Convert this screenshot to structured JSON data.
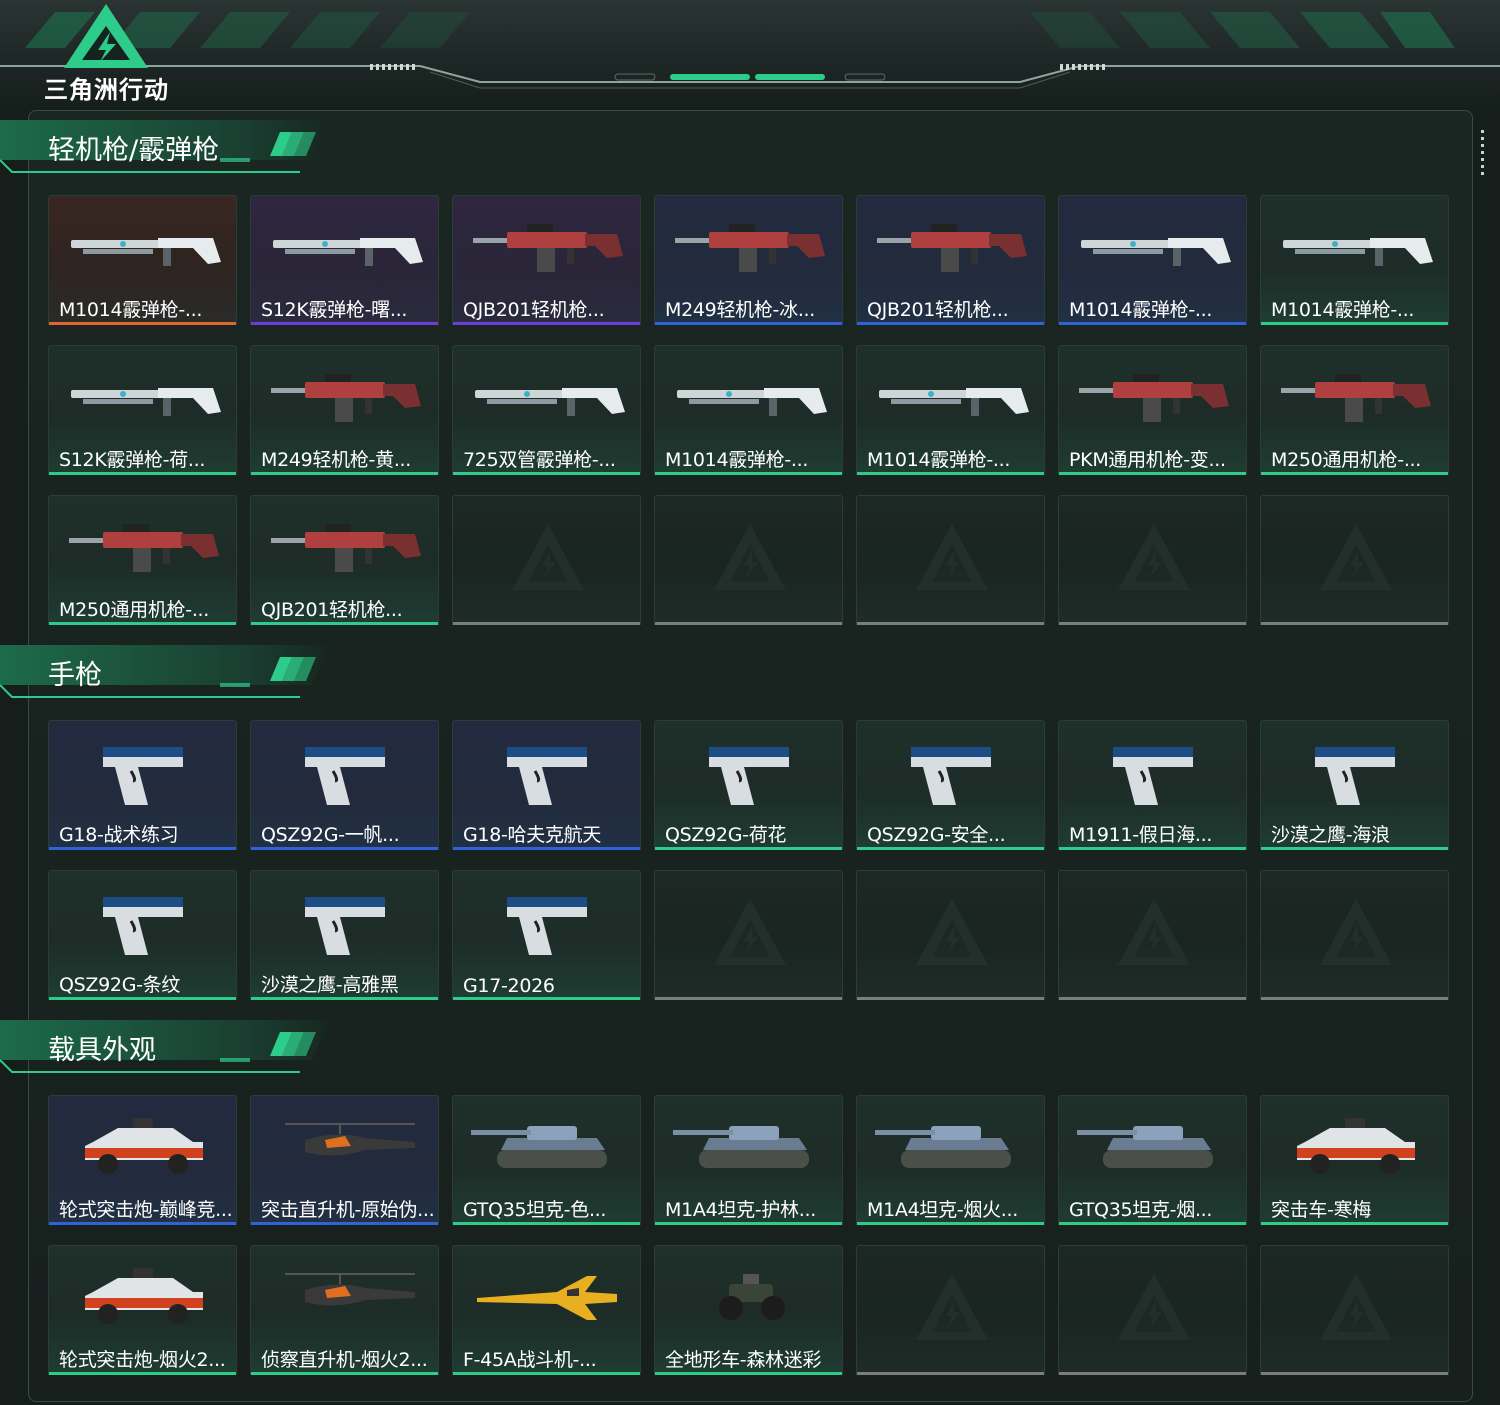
{
  "app": {
    "logo_text": "三角洲行动"
  },
  "colors": {
    "accent": "#2ecc8a",
    "bar_orange": "#e0652a",
    "bar_purple": "#6a3fd8",
    "bar_blue": "#2e63d9",
    "bar_green": "#2ecc8a",
    "bar_gray": "#7a7f7d"
  },
  "sections": [
    {
      "title": "轻机枪/霰弹枪",
      "items": [
        {
          "name": "M1014霰弹枪-...",
          "rarity": "orange",
          "icon": "shotgun-icon"
        },
        {
          "name": "S12K霰弹枪-曙...",
          "rarity": "purple",
          "icon": "shotgun-icon"
        },
        {
          "name": "QJB201轻机枪...",
          "rarity": "purple",
          "icon": "machine-gun-icon"
        },
        {
          "name": "M249轻机枪-冰...",
          "rarity": "blue",
          "icon": "machine-gun-icon"
        },
        {
          "name": "QJB201轻机枪...",
          "rarity": "blue",
          "icon": "machine-gun-icon"
        },
        {
          "name": "M1014霰弹枪-...",
          "rarity": "blue",
          "icon": "shotgun-icon"
        },
        {
          "name": "M1014霰弹枪-...",
          "rarity": "green",
          "icon": "shotgun-icon"
        },
        {
          "name": "S12K霰弹枪-荷...",
          "rarity": "green",
          "icon": "shotgun-icon"
        },
        {
          "name": "M249轻机枪-黄...",
          "rarity": "green",
          "icon": "machine-gun-icon"
        },
        {
          "name": "725双管霰弹枪-...",
          "rarity": "green",
          "icon": "shotgun-icon"
        },
        {
          "name": "M1014霰弹枪-...",
          "rarity": "green",
          "icon": "shotgun-icon"
        },
        {
          "name": "M1014霰弹枪-...",
          "rarity": "green",
          "icon": "shotgun-icon"
        },
        {
          "name": "PKM通用机枪-变...",
          "rarity": "green",
          "icon": "machine-gun-icon"
        },
        {
          "name": "M250通用机枪-...",
          "rarity": "green",
          "icon": "machine-gun-icon"
        },
        {
          "name": "M250通用机枪-...",
          "rarity": "green",
          "icon": "machine-gun-icon"
        },
        {
          "name": "QJB201轻机枪...",
          "rarity": "green",
          "icon": "machine-gun-icon"
        },
        {
          "empty": true
        },
        {
          "empty": true
        },
        {
          "empty": true
        },
        {
          "empty": true
        },
        {
          "empty": true
        }
      ]
    },
    {
      "title": "手枪",
      "items": [
        {
          "name": "G18-战术练习",
          "rarity": "blue",
          "icon": "pistol-icon"
        },
        {
          "name": "QSZ92G-一帆...",
          "rarity": "blue",
          "icon": "pistol-icon"
        },
        {
          "name": "G18-哈夫克航天",
          "rarity": "blue",
          "icon": "pistol-icon"
        },
        {
          "name": "QSZ92G-荷花",
          "rarity": "green",
          "icon": "pistol-icon"
        },
        {
          "name": "QSZ92G-安全...",
          "rarity": "green",
          "icon": "pistol-icon"
        },
        {
          "name": "M1911-假日海...",
          "rarity": "green",
          "icon": "pistol-icon"
        },
        {
          "name": "沙漠之鹰-海浪",
          "rarity": "green",
          "icon": "pistol-icon"
        },
        {
          "name": "QSZ92G-条纹",
          "rarity": "green",
          "icon": "pistol-icon"
        },
        {
          "name": "沙漠之鹰-高雅黑",
          "rarity": "green",
          "icon": "pistol-icon"
        },
        {
          "name": "G17-2026",
          "rarity": "green",
          "icon": "pistol-icon"
        },
        {
          "empty": true
        },
        {
          "empty": true
        },
        {
          "empty": true
        },
        {
          "empty": true
        }
      ]
    },
    {
      "title": "载具外观",
      "items": [
        {
          "name": "轮式突击炮-巅峰竞...",
          "rarity": "blue",
          "icon": "armored-car-icon"
        },
        {
          "name": "突击直升机-原始伪...",
          "rarity": "blue",
          "icon": "helicopter-icon"
        },
        {
          "name": "GTQ35坦克-色...",
          "rarity": "green",
          "icon": "tank-icon"
        },
        {
          "name": "M1A4坦克-护林...",
          "rarity": "green",
          "icon": "tank-icon"
        },
        {
          "name": "M1A4坦克-烟火...",
          "rarity": "green",
          "icon": "tank-icon"
        },
        {
          "name": "GTQ35坦克-烟...",
          "rarity": "green",
          "icon": "tank-icon"
        },
        {
          "name": "突击车-寒梅",
          "rarity": "green",
          "icon": "armored-car-icon"
        },
        {
          "name": "轮式突击炮-烟火2...",
          "rarity": "green",
          "icon": "armored-car-icon"
        },
        {
          "name": "侦察直升机-烟火2...",
          "rarity": "green",
          "icon": "helicopter-icon"
        },
        {
          "name": "F-45A战斗机-...",
          "rarity": "green",
          "icon": "jet-icon"
        },
        {
          "name": "全地形车-森林迷彩",
          "rarity": "green",
          "icon": "atv-icon"
        },
        {
          "empty": true
        },
        {
          "empty": true
        },
        {
          "empty": true
        }
      ]
    }
  ]
}
